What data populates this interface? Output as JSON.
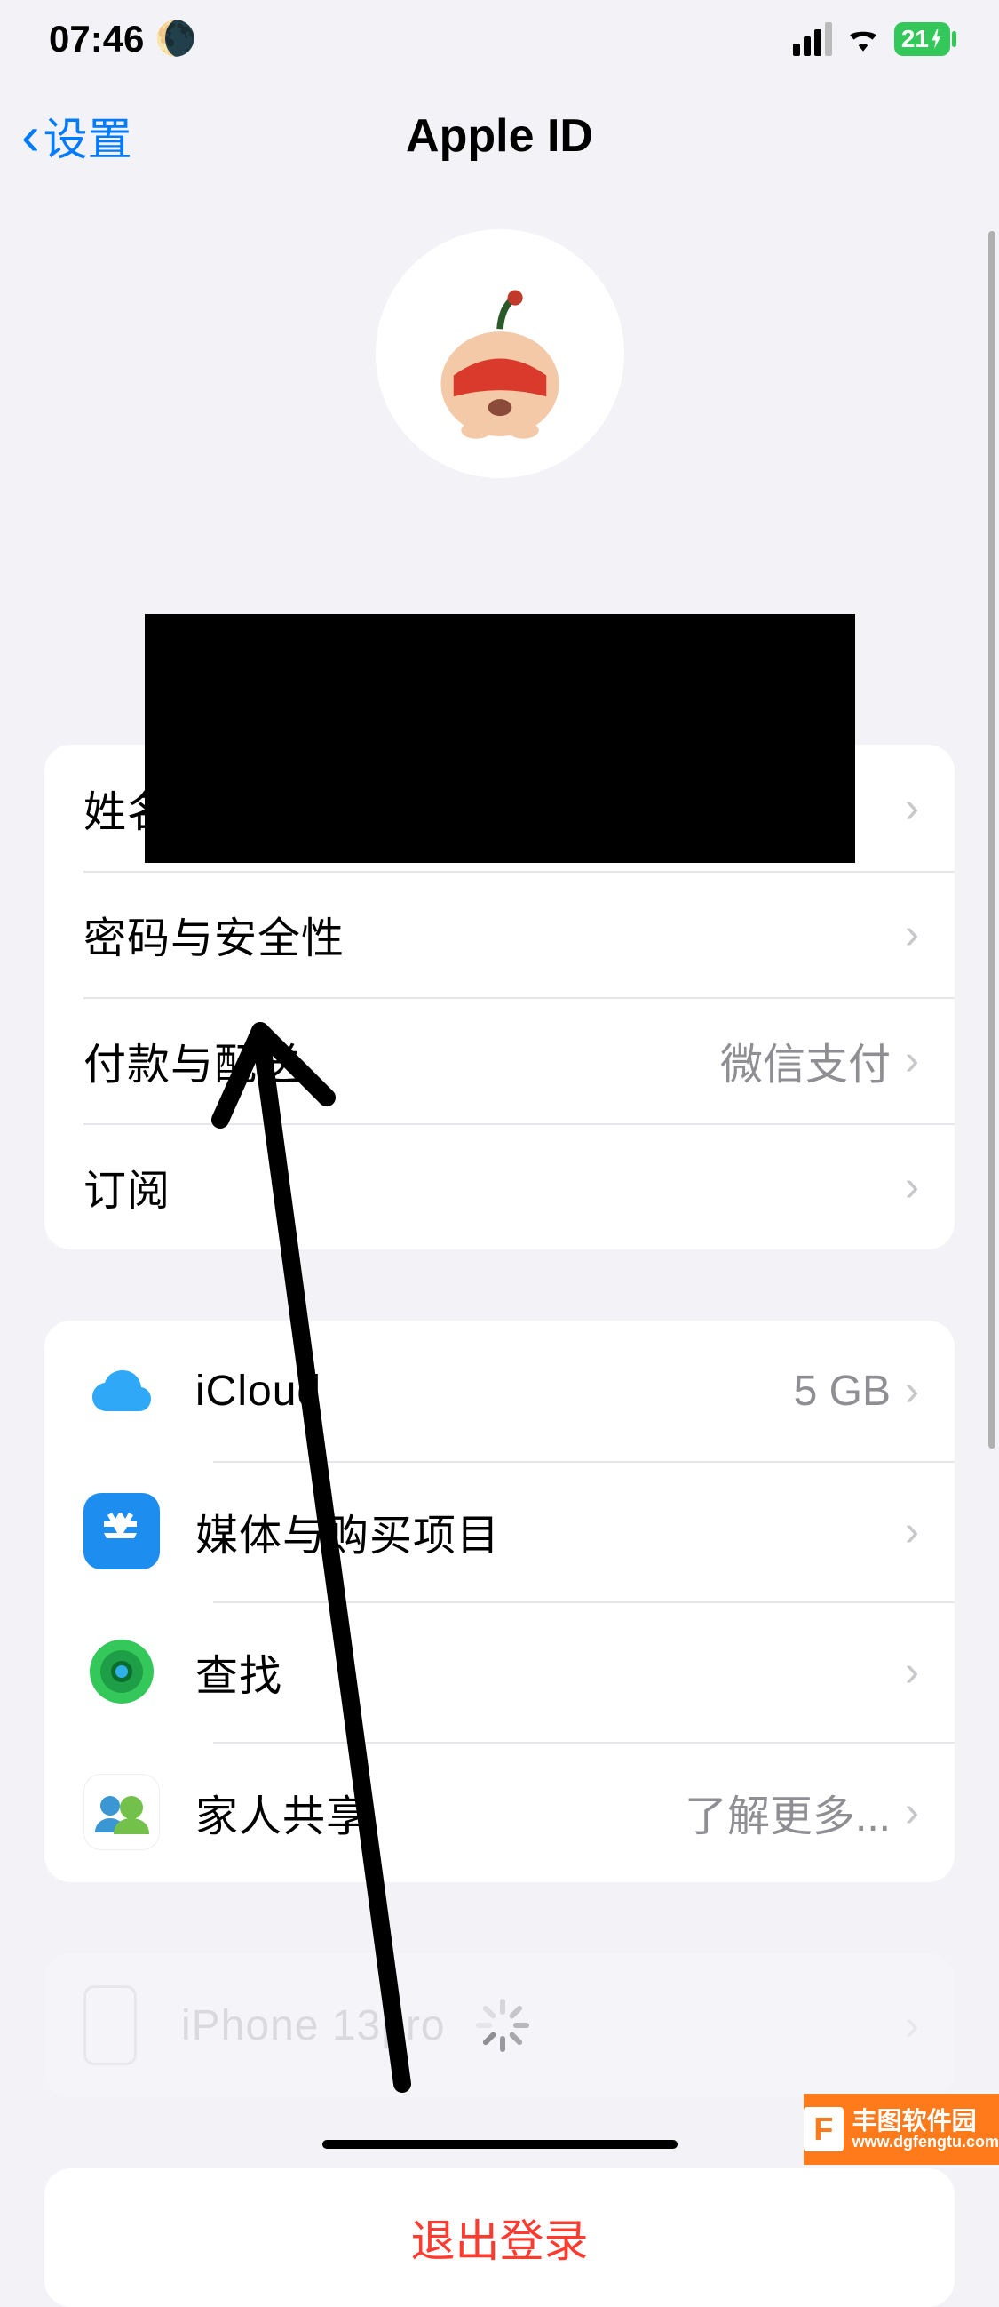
{
  "status": {
    "time": "07:46",
    "battery": "21"
  },
  "nav": {
    "back": "设置",
    "title": "Apple ID"
  },
  "section1": {
    "name_phone_email": "姓名、电话号码、电子邮件",
    "password_security": "密码与安全性",
    "payment_shipping": "付款与配送",
    "payment_value": "微信支付",
    "subscriptions": "订阅"
  },
  "section2": {
    "icloud": "iCloud",
    "icloud_value": "5 GB",
    "media_purchases": "媒体与购买项目",
    "find": "查找",
    "family": "家人共享",
    "family_value": "了解更多..."
  },
  "device": {
    "name": "iPhone 13pro"
  },
  "signout": "退出登录",
  "watermark": {
    "title": "丰图软件园",
    "url": "www.dgfengtu.com"
  }
}
